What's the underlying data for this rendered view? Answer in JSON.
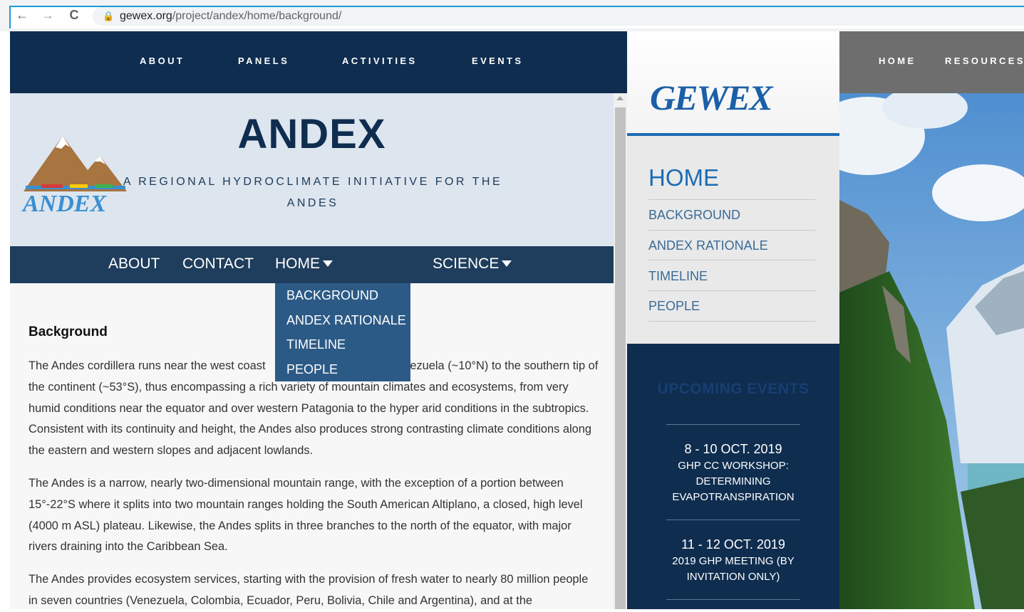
{
  "browser": {
    "back": "←",
    "forward": "→",
    "reload": "C",
    "lock": "🔒",
    "url_host": "gewex.org",
    "url_path": "/project/andex/home/background/"
  },
  "left_window": {
    "top_nav": [
      "ABOUT",
      "PANELS",
      "ACTIVITIES",
      "EVENTS"
    ],
    "title": "ANDEX",
    "subtitle_line1": "A REGIONAL HYDROCLIMATE INITIATIVE FOR THE",
    "subtitle_line2": "ANDES",
    "sub_nav": {
      "about": "ABOUT",
      "contact": "CONTACT",
      "home": "HOME",
      "science": "SCIENCE"
    },
    "dropdown": [
      "BACKGROUND",
      "ANDEX RATIONALE",
      "TIMELINE",
      "PEOPLE"
    ],
    "heading": "Background",
    "para1_before": "The Andes cordillera runs near the west coast",
    "para1_after": "enezuela (~10°N) to the southern",
    "para1_rest": "tip of the continent (~53°S), thus encompassing a rich variety of mountain climates and ecosystems, from very humid conditions near the equator and over western Patagonia to the hyper arid conditions in the subtropics. Consistent with its continuity and height, the Andes also produces strong contrasting climate conditions along the eastern and western slopes and adjacent lowlands.",
    "para2": "The Andes is a narrow, nearly two-dimensional mountain range, with the exception of a portion between 15°-22°S where it splits into two mountain ranges holding the South American Altiplano, a closed, high level (4000 m ASL) plateau. Likewise, the Andes splits in three branches to the north of the equator, with major rivers draining into the Caribbean Sea.",
    "para3": "The Andes provides ecosystem services, starting with the provision of fresh water to nearly 80 million people in seven countries (Venezuela, Colombia, Ecuador, Peru, Bolivia, Chile and Argentina), and at the"
  },
  "middle_window": {
    "logo_text": "GEWEX",
    "menu_home": "HOME",
    "menu_items": [
      "BACKGROUND",
      "ANDEX RATIONALE",
      "TIMELINE",
      "PEOPLE"
    ],
    "events_title": "UPCOMING EVENTS",
    "events": [
      {
        "date": "8 - 10 OCT. 2019",
        "name": "GHP CC WORKSHOP: DETERMINING EVAPOTRANSPIRATION"
      },
      {
        "date": "11 - 12 OCT. 2019",
        "name": "2019 GHP MEETING (BY INVITATION ONLY)"
      }
    ]
  },
  "right_window": {
    "nav": [
      "HOME",
      "RESOURCES"
    ]
  },
  "colors": {
    "navy": "#0f2d4f",
    "accent_blue": "#1c6cb3",
    "dropdown": "#2c5a86"
  }
}
